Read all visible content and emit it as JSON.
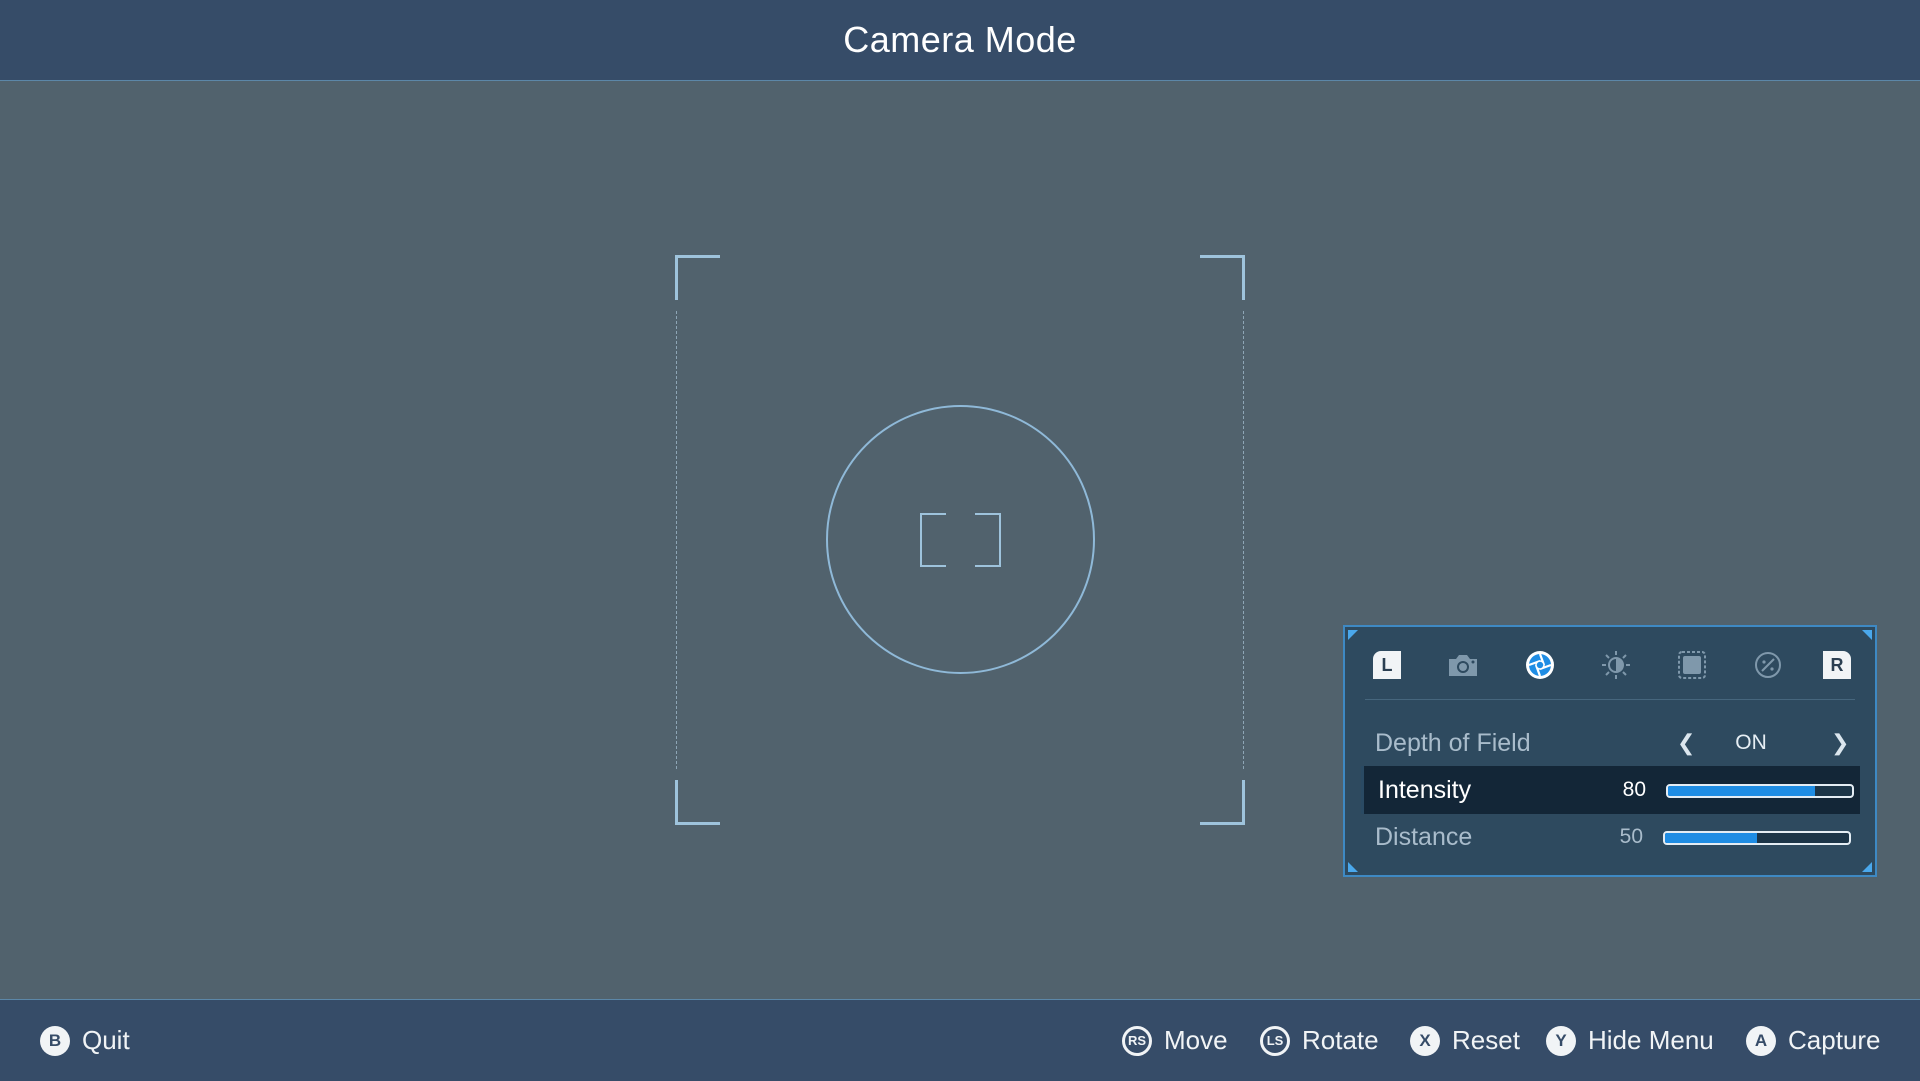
{
  "header": {
    "title": "Camera Mode"
  },
  "panel": {
    "tabs": [
      {
        "id": "shoulder-l",
        "label": "L"
      },
      {
        "id": "camera",
        "icon": "camera-icon"
      },
      {
        "id": "aperture",
        "icon": "aperture-icon",
        "active": true
      },
      {
        "id": "brightness",
        "icon": "brightness-icon"
      },
      {
        "id": "frame",
        "icon": "frame-icon"
      },
      {
        "id": "filter",
        "icon": "filter-icon"
      },
      {
        "id": "shoulder-r",
        "label": "R"
      }
    ],
    "rows": [
      {
        "label": "Depth of Field",
        "value": "ON",
        "type": "option"
      },
      {
        "label": "Intensity",
        "value": "80",
        "fill": 0.8,
        "type": "slider",
        "selected": true
      },
      {
        "label": "Distance",
        "value": "50",
        "fill": 0.5,
        "type": "slider"
      }
    ]
  },
  "footer": {
    "quit": {
      "button": "B",
      "label": "Quit"
    },
    "move": {
      "button": "RS",
      "label": "Move"
    },
    "rotate": {
      "button": "LS",
      "label": "Rotate"
    },
    "reset": {
      "button": "X",
      "label": "Reset"
    },
    "hide": {
      "button": "Y",
      "label": "Hide Menu"
    },
    "capture": {
      "button": "A",
      "label": "Capture"
    }
  },
  "colors": {
    "accent": "#1f8de4",
    "bar": "#364c68",
    "background": "#51626d"
  }
}
